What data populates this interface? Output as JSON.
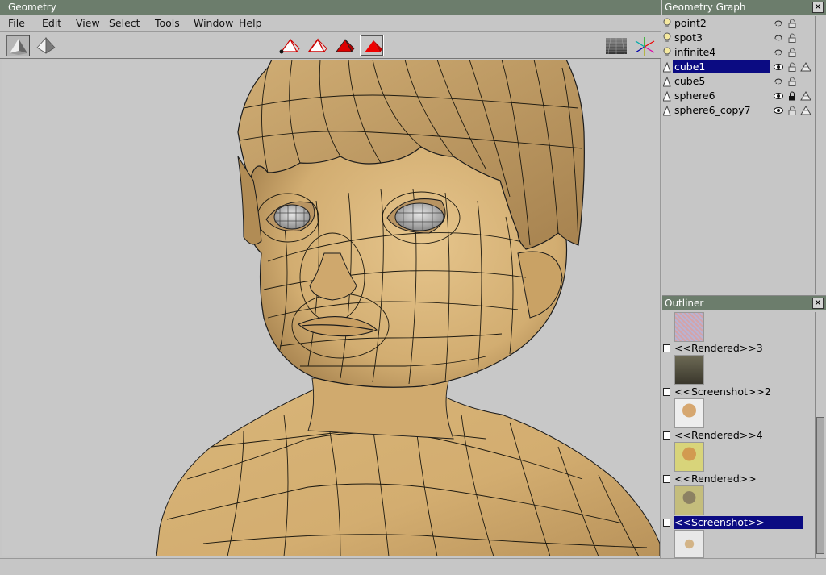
{
  "geometry_window": {
    "title": "Geometry",
    "menu": [
      "File",
      "Edit",
      "View",
      "Select",
      "Tools",
      "Window",
      "Help"
    ]
  },
  "toolbar": {
    "buttons": [
      {
        "name": "shaded-mode-icon",
        "pressed": true
      },
      {
        "name": "flat-mode-icon",
        "pressed": false
      },
      {
        "name": "vertex-select-icon",
        "pressed": false
      },
      {
        "name": "edge-select-icon",
        "pressed": false
      },
      {
        "name": "face-select-icon",
        "pressed": false
      },
      {
        "name": "object-select-icon",
        "pressed": true
      },
      {
        "name": "grid-icon",
        "pressed": false
      },
      {
        "name": "axes-icon",
        "pressed": false
      }
    ]
  },
  "geometry_graph": {
    "title": "Geometry Graph",
    "items": [
      {
        "label": "point2",
        "type": "light",
        "visible": false,
        "locked": false,
        "mesh": false
      },
      {
        "label": "spot3",
        "type": "light",
        "visible": false,
        "locked": false,
        "mesh": false
      },
      {
        "label": "infinite4",
        "type": "light",
        "visible": false,
        "locked": false,
        "mesh": false
      },
      {
        "label": "cube1",
        "type": "mesh",
        "visible": true,
        "locked": false,
        "mesh": true,
        "selected": true
      },
      {
        "label": "cube5",
        "type": "mesh",
        "visible": false,
        "locked": false,
        "mesh": false
      },
      {
        "label": "sphere6",
        "type": "mesh",
        "visible": true,
        "locked": true,
        "mesh": true
      },
      {
        "label": "sphere6_copy7",
        "type": "mesh",
        "visible": true,
        "locked": false,
        "mesh": true
      }
    ]
  },
  "outliner": {
    "title": "Outliner",
    "items": [
      {
        "label": "<<Rendered>>3"
      },
      {
        "label": "<<Screenshot>>2"
      },
      {
        "label": "<<Rendered>>4"
      },
      {
        "label": "<<Rendered>>"
      },
      {
        "label": "<<Screenshot>>",
        "selected": true
      }
    ]
  },
  "colors": {
    "title_bar": "#6c7d6c",
    "selection": "#0b0b82",
    "skin": "#d8b378",
    "viewport_bg": "#c8c8c8"
  }
}
